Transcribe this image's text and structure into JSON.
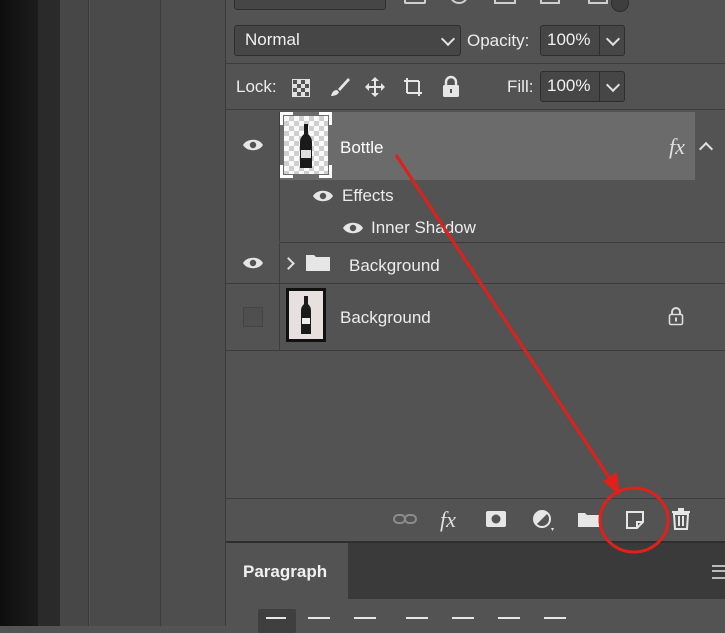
{
  "layers_panel": {
    "blend_mode": "Normal",
    "opacity_label": "Opacity:",
    "opacity_value": "100%",
    "lock_label": "Lock:",
    "fill_label": "Fill:",
    "fill_value": "100%",
    "layers": [
      {
        "name": "Bottle",
        "visible": true,
        "selected": true,
        "has_fx": true,
        "fx_label": "fx"
      },
      {
        "name": "Effects",
        "visible": true,
        "type": "effects-group"
      },
      {
        "name": "Inner Shadow",
        "visible": true,
        "type": "effect"
      },
      {
        "name": "Background",
        "visible": true,
        "type": "group"
      },
      {
        "name": "Background",
        "visible": false,
        "locked": true,
        "type": "layer"
      }
    ],
    "footer_fx_label": "fx"
  },
  "paragraph_panel": {
    "tab_label": "Paragraph"
  },
  "colors": {
    "annotation": "#e0201a",
    "panel_bg": "#535353",
    "selected_row": "#6b6b6b"
  },
  "annotation": {
    "type": "arrow-and-circle",
    "target": "new-layer-button"
  }
}
